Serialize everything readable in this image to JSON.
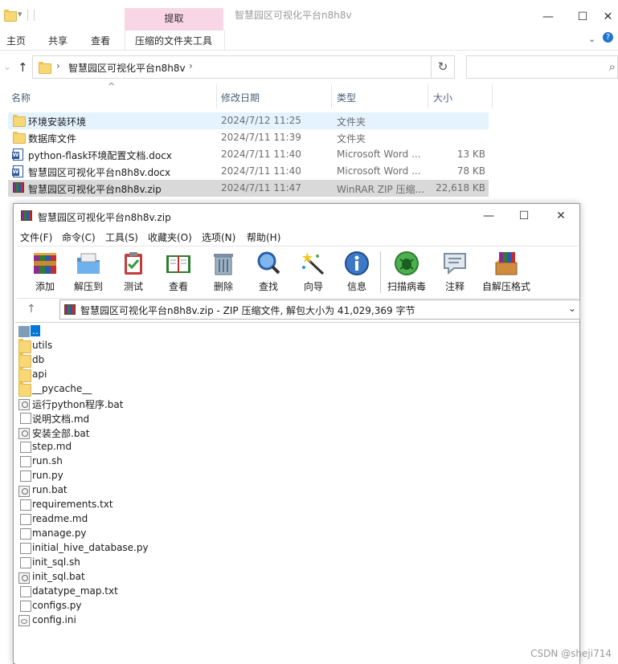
{
  "explorer": {
    "quick_access_glyph": "▾",
    "context_tab": "提取",
    "window_title": "智慧园区可视化平台n8h8v",
    "window_buttons": {
      "minimize": "—",
      "maximize": "☐",
      "close": "✕"
    },
    "ribbon_tabs": [
      "主页",
      "共享",
      "查看",
      "压缩的文件夹工具"
    ],
    "help_glyph": "?",
    "expand_glyph": "⌄",
    "nav": {
      "back": "←",
      "forward": "→",
      "recent": "⌄",
      "up": "↑"
    },
    "address": {
      "chevron": "›",
      "path": "智慧园区可视化平台n8h8v",
      "trail": "›"
    },
    "refresh_glyph": "↻",
    "search_glyph": "⌕",
    "sort_glyph": "^",
    "columns": {
      "name": "名称",
      "date": "修改日期",
      "type": "类型",
      "size": "大小"
    },
    "files": [
      {
        "icon": "folder-icon",
        "name": "环境安装环境",
        "date": "2024/7/12 11:25",
        "type": "文件夹",
        "size": ""
      },
      {
        "icon": "folder-icon",
        "name": "数据库文件",
        "date": "2024/7/11 11:39",
        "type": "文件夹",
        "size": ""
      },
      {
        "icon": "word-icon",
        "name": "python-flask环境配置文档.docx",
        "date": "2024/7/11 11:40",
        "type": "Microsoft Word ...",
        "size": "13 KB"
      },
      {
        "icon": "word-icon",
        "name": "智慧园区可视化平台n8h8v.docx",
        "date": "2024/7/11 11:40",
        "type": "Microsoft Word ...",
        "size": "78 KB"
      },
      {
        "icon": "winrar-icon",
        "name": "智慧园区可视化平台n8h8v.zip",
        "date": "2024/7/11 11:47",
        "type": "WinRAR ZIP 压缩...",
        "size": "22,618 KB"
      }
    ]
  },
  "winrar": {
    "title": "智慧园区可视化平台n8h8v.zip",
    "window_buttons": {
      "minimize": "—",
      "maximize": "☐",
      "close": "✕"
    },
    "menu": [
      "文件(F)",
      "命令(C)",
      "工具(S)",
      "收藏夹(O)",
      "选项(N)",
      "帮助(H)"
    ],
    "toolbar": [
      {
        "label": "添加",
        "icon": "add-archive-icon"
      },
      {
        "label": "解压到",
        "icon": "extract-to-folder-icon"
      },
      {
        "label": "测试",
        "icon": "test-clipboard-icon"
      },
      {
        "label": "查看",
        "icon": "view-book-icon"
      },
      {
        "label": "删除",
        "icon": "delete-trash-icon"
      },
      {
        "label": "查找",
        "icon": "find-magnifier-icon"
      },
      {
        "label": "向导",
        "icon": "wizard-wand-icon"
      },
      {
        "label": "信息",
        "icon": "info-icon"
      },
      {
        "label": "扫描病毒",
        "icon": "virus-scan-icon"
      },
      {
        "label": "注释",
        "icon": "comment-icon"
      },
      {
        "label": "自解压格式",
        "icon": "sfx-box-icon"
      }
    ],
    "path_bar": {
      "up": "↑",
      "text": "智慧园区可视化平台n8h8v.zip - ZIP 压缩文件, 解包大小为 41,029,369 字节",
      "chevron": "⌄"
    },
    "entries": [
      {
        "name": "..",
        "icon": "parent-folder-icon"
      },
      {
        "name": "utils",
        "icon": "folder-icon"
      },
      {
        "name": "db",
        "icon": "folder-icon"
      },
      {
        "name": "api",
        "icon": "folder-icon"
      },
      {
        "name": "__pycache__",
        "icon": "folder-icon"
      },
      {
        "name": "运行python程序.bat",
        "icon": "batch-file-icon"
      },
      {
        "name": "说明文档.md",
        "icon": "file-icon"
      },
      {
        "name": "安装全部.bat",
        "icon": "batch-file-icon"
      },
      {
        "name": "step.md",
        "icon": "file-icon"
      },
      {
        "name": "run.sh",
        "icon": "file-icon"
      },
      {
        "name": "run.py",
        "icon": "file-icon"
      },
      {
        "name": "run.bat",
        "icon": "batch-file-icon"
      },
      {
        "name": "requirements.txt",
        "icon": "file-icon"
      },
      {
        "name": "readme.md",
        "icon": "file-icon"
      },
      {
        "name": "manage.py",
        "icon": "file-icon"
      },
      {
        "name": "initial_hive_database.py",
        "icon": "file-icon"
      },
      {
        "name": "init_sql.sh",
        "icon": "file-icon"
      },
      {
        "name": "init_sql.bat",
        "icon": "batch-file-icon"
      },
      {
        "name": "datatype_map.txt",
        "icon": "file-icon"
      },
      {
        "name": "configs.py",
        "icon": "file-icon"
      },
      {
        "name": "config.ini",
        "icon": "config-file-icon"
      }
    ]
  },
  "watermark": "CSDN @sheji714"
}
